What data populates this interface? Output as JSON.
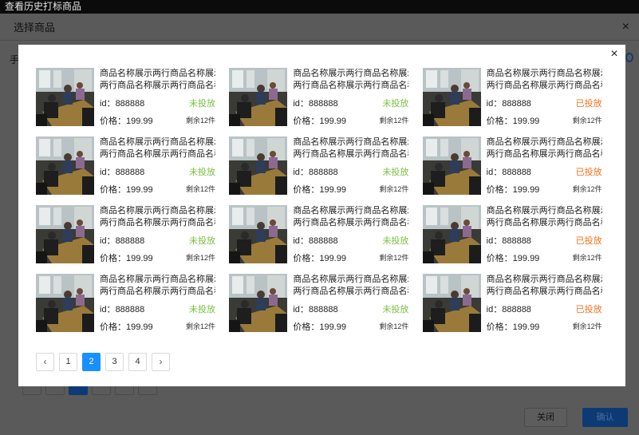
{
  "topbar": {
    "title": "查看历史打标商品"
  },
  "base_dialog": {
    "title": "选择商品",
    "close": "×",
    "peek_text": "手",
    "cancel_label": "关闭",
    "confirm_label": "确认"
  },
  "modal": {
    "close": "×",
    "products": [
      {
        "name1": "商品名称展示两行商品名称展示",
        "name2": "两行商品名称展示两行商品名称",
        "id_label": "id：",
        "id": "888888",
        "status": "未投放",
        "status_type": "off",
        "price_label": "价格：",
        "price": "199.99",
        "stock": "剩余12件"
      },
      {
        "name1": "商品名称展示两行商品名称展示",
        "name2": "两行商品名称展示两行商品名称",
        "id_label": "id：",
        "id": "888888",
        "status": "未投放",
        "status_type": "off",
        "price_label": "价格：",
        "price": "199.99",
        "stock": "剩余12件"
      },
      {
        "name1": "商品名称展示两行商品名称展示",
        "name2": "两行商品名称展示两行商品名称",
        "id_label": "id：",
        "id": "888888",
        "status": "已投放",
        "status_type": "on",
        "price_label": "价格：",
        "price": "199.99",
        "stock": "剩余12件"
      },
      {
        "name1": "商品名称展示两行商品名称展示",
        "name2": "两行商品名称展示两行商品名称",
        "id_label": "id：",
        "id": "888888",
        "status": "未投放",
        "status_type": "off",
        "price_label": "价格：",
        "price": "199.99",
        "stock": "剩余12件"
      },
      {
        "name1": "商品名称展示两行商品名称展示",
        "name2": "两行商品名称展示两行商品名称",
        "id_label": "id：",
        "id": "888888",
        "status": "未投放",
        "status_type": "off",
        "price_label": "价格：",
        "price": "199.99",
        "stock": "剩余12件"
      },
      {
        "name1": "商品名称展示两行商品名称展示",
        "name2": "两行商品名称展示两行商品名称",
        "id_label": "id：",
        "id": "888888",
        "status": "已投放",
        "status_type": "on",
        "price_label": "价格：",
        "price": "199.99",
        "stock": "剩余12件"
      },
      {
        "name1": "商品名称展示两行商品名称展示",
        "name2": "两行商品名称展示两行商品名称",
        "id_label": "id：",
        "id": "888888",
        "status": "未投放",
        "status_type": "off",
        "price_label": "价格：",
        "price": "199.99",
        "stock": "剩余12件"
      },
      {
        "name1": "商品名称展示两行商品名称展示",
        "name2": "两行商品名称展示两行商品名称",
        "id_label": "id：",
        "id": "888888",
        "status": "未投放",
        "status_type": "off",
        "price_label": "价格：",
        "price": "199.99",
        "stock": "剩余12件"
      },
      {
        "name1": "商品名称展示两行商品名称展示",
        "name2": "两行商品名称展示两行商品名称",
        "id_label": "id：",
        "id": "888888",
        "status": "已投放",
        "status_type": "on",
        "price_label": "价格：",
        "price": "199.99",
        "stock": "剩余12件"
      },
      {
        "name1": "商品名称展示两行商品名称展示",
        "name2": "两行商品名称展示两行商品名称",
        "id_label": "id：",
        "id": "888888",
        "status": "未投放",
        "status_type": "off",
        "price_label": "价格：",
        "price": "199.99",
        "stock": "剩余12件"
      },
      {
        "name1": "商品名称展示两行商品名称展示",
        "name2": "两行商品名称展示两行商品名称",
        "id_label": "id：",
        "id": "888888",
        "status": "未投放",
        "status_type": "off",
        "price_label": "价格：",
        "price": "199.99",
        "stock": "剩余12件"
      },
      {
        "name1": "商品名称展示两行商品名称展示",
        "name2": "两行商品名称展示两行商品名称",
        "id_label": "id：",
        "id": "888888",
        "status": "已投放",
        "status_type": "on",
        "price_label": "价格：",
        "price": "199.99",
        "stock": "剩余12件"
      }
    ],
    "pagination": {
      "prev": "‹",
      "next": "›",
      "pages": [
        "1",
        "2",
        "3",
        "4"
      ],
      "current": "2"
    }
  },
  "colors": {
    "accent": "#1890ff",
    "status_off": "#7ac143",
    "status_on": "#f2711c",
    "base_primary": "#0d3a75"
  }
}
